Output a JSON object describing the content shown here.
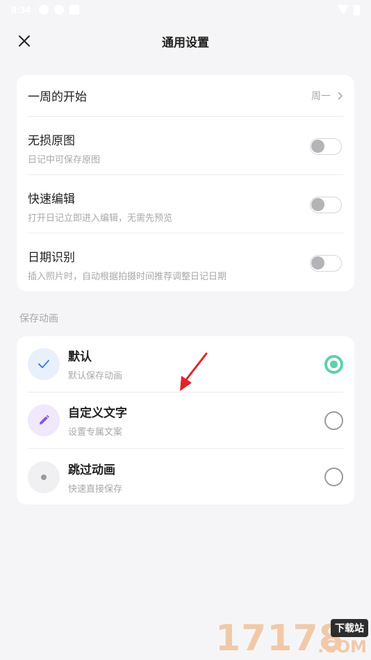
{
  "status_bar": {
    "time": "8:34"
  },
  "header": {
    "title": "通用设置"
  },
  "general": {
    "week_start": {
      "label": "一周的开始",
      "value": "周一"
    },
    "toggles": [
      {
        "label": "无损原图",
        "description": "日记中可保存原图",
        "on": false
      },
      {
        "label": "快速编辑",
        "description": "打开日记立即进入编辑，无需先预览",
        "on": false
      },
      {
        "label": "日期识别",
        "description": "插入照片时，自动根据拍摄时间推荐调整日记日期",
        "on": false
      }
    ]
  },
  "save_animation": {
    "section_label": "保存动画",
    "options": [
      {
        "label": "默认",
        "description": "默认保存动画",
        "icon": "check-icon",
        "selected": true
      },
      {
        "label": "自定义文字",
        "description": "设置专属文案",
        "icon": "pencil-icon",
        "selected": false
      },
      {
        "label": "跳过动画",
        "description": "快速直接保存",
        "icon": "dot-icon",
        "selected": false
      }
    ]
  },
  "colors": {
    "accent_green": "#5fd0a9",
    "check_blue": "#3f7fe0",
    "pencil_purple": "#8a52e0",
    "annotation_red": "#e3232a"
  },
  "watermark": {
    "digits": "17178",
    "tag": "下载站",
    "suffix": ".COM"
  }
}
